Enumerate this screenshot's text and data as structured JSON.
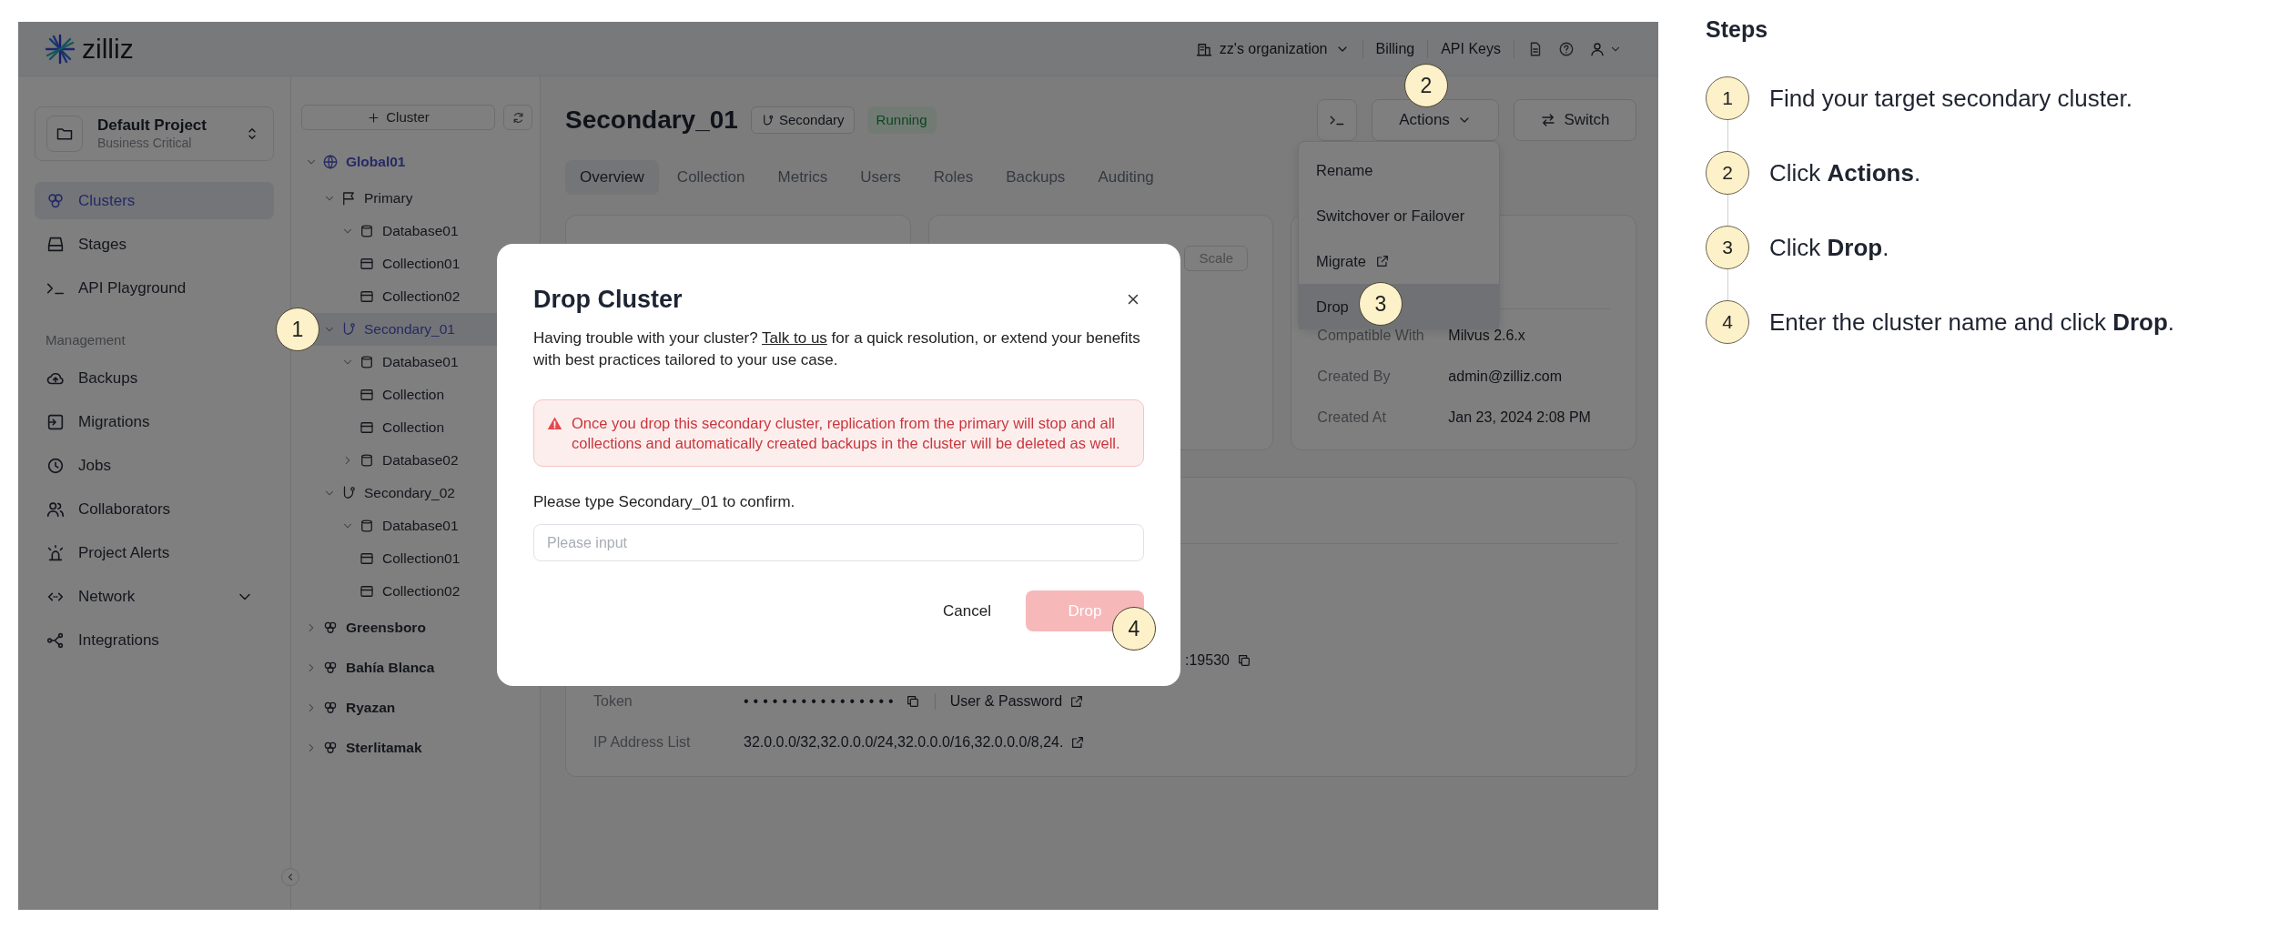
{
  "topbar": {
    "logo": "zilliz",
    "organization": "zz's organization",
    "links": [
      "Billing",
      "API Keys"
    ]
  },
  "sidebar": {
    "project": {
      "name": "Default Project",
      "plan": "Business Critical"
    },
    "items": [
      {
        "label": "Clusters",
        "kind": "clusters",
        "selected": true
      },
      {
        "label": "Stages",
        "kind": "stages",
        "selected": false
      },
      {
        "label": "API Playground",
        "kind": "playground",
        "selected": false
      }
    ],
    "section_title": "Management",
    "section_items": [
      {
        "label": "Backups",
        "kind": "backups",
        "selected": false
      },
      {
        "label": "Migrations",
        "kind": "migrations",
        "selected": false
      },
      {
        "label": "Jobs",
        "kind": "jobs",
        "selected": false
      },
      {
        "label": "Collaborators",
        "kind": "collaborators",
        "selected": false
      },
      {
        "label": "Project Alerts",
        "kind": "alerts",
        "selected": false
      },
      {
        "label": "Network",
        "kind": "network",
        "selected": false,
        "expanded": false
      },
      {
        "label": "Integrations",
        "kind": "integrations",
        "selected": false
      }
    ]
  },
  "tree": {
    "add_button": "Cluster",
    "nodes": [
      {
        "label": "Global01",
        "kind": "global",
        "expanded": true,
        "selected": false,
        "children": [
          {
            "label": "Primary",
            "kind": "primary",
            "expanded": true,
            "selected": false,
            "children": [
              {
                "label": "Database01",
                "kind": "database",
                "expanded": true,
                "selected": false,
                "children": [
                  {
                    "label": "Collection01",
                    "kind": "collection",
                    "selected": false
                  },
                  {
                    "label": "Collection02",
                    "kind": "collection",
                    "selected": false
                  }
                ]
              }
            ]
          },
          {
            "label": "Secondary_01",
            "kind": "secondary",
            "expanded": true,
            "selected": true,
            "children": [
              {
                "label": "Database01",
                "kind": "database",
                "expanded": true,
                "selected": false,
                "children": [
                  {
                    "label": "Collection",
                    "kind": "collection",
                    "selected": false
                  },
                  {
                    "label": "Collection",
                    "kind": "collection",
                    "selected": false
                  }
                ]
              },
              {
                "label": "Database02",
                "kind": "database",
                "expanded": false,
                "selected": false
              }
            ]
          },
          {
            "label": "Secondary_02",
            "kind": "secondary",
            "expanded": true,
            "selected": false,
            "children": [
              {
                "label": "Database01",
                "kind": "database",
                "expanded": true,
                "selected": false,
                "children": [
                  {
                    "label": "Collection01",
                    "kind": "collection",
                    "selected": false
                  },
                  {
                    "label": "Collection02",
                    "kind": "collection",
                    "selected": false
                  }
                ]
              }
            ]
          }
        ]
      },
      {
        "label": "Greensboro",
        "kind": "cluster",
        "expanded": false,
        "selected": false
      },
      {
        "label": "Bahía Blanca",
        "kind": "cluster",
        "expanded": false,
        "selected": false
      },
      {
        "label": "Ryazan",
        "kind": "cluster",
        "expanded": false,
        "selected": false
      },
      {
        "label": "Sterlitamak",
        "kind": "cluster",
        "expanded": false,
        "selected": false
      }
    ]
  },
  "header": {
    "title": "Secondary_01",
    "role": "Secondary",
    "status": "Running",
    "actions_button": "Actions",
    "switch_button": "Switch"
  },
  "tabs": [
    {
      "label": "Overview",
      "selected": true
    },
    {
      "label": "Collection",
      "selected": false
    },
    {
      "label": "Metrics",
      "selected": false
    },
    {
      "label": "Users",
      "selected": false
    },
    {
      "label": "Roles",
      "selected": false
    },
    {
      "label": "Backups",
      "selected": false
    },
    {
      "label": "Auditing",
      "selected": false
    }
  ],
  "actions_menu": [
    {
      "label": "Rename",
      "external": false,
      "highlighted": false
    },
    {
      "label": "Switchover or Failover",
      "external": false,
      "highlighted": false
    },
    {
      "label": "Migrate",
      "external": true,
      "highlighted": false
    },
    {
      "label": "Drop",
      "external": false,
      "highlighted": true
    }
  ],
  "scale_button": "Scale",
  "details": [
    {
      "label": "Compatible With",
      "value": "Milvus 2.6.x"
    },
    {
      "label": "Created By",
      "value": "admin@zilliz.com"
    },
    {
      "label": "Created At",
      "value": "Jan 23, 2024 2:08 PM"
    }
  ],
  "connection": {
    "endpoint": ":19530",
    "token_label": "Token",
    "token_value": "••••••••••••••••",
    "auth": "User & Password",
    "ip_label": "IP Address List",
    "ip_value": "32.0.0.0/32,32.0.0.0/24,32.0.0.0/16,32.0.0.0/8,24."
  },
  "modal": {
    "title": "Drop Cluster",
    "intro_before": "Having trouble with your cluster? ",
    "intro_link": "Talk to us",
    "intro_after": " for a quick resolution, or extend your benefits with best practices tailored to your use case.",
    "warning": "Once you drop this secondary cluster, replication from the primary will stop and all collections and automatically created backups in the cluster will be deleted as well.",
    "confirm_label": "Please type Secondary_01 to confirm.",
    "placeholder": "Please input",
    "cancel_button": "Cancel",
    "drop_button": "Drop",
    "drop_disabled": true
  },
  "callouts": [
    "1",
    "2",
    "3",
    "4"
  ],
  "steps": {
    "title": "Steps",
    "items": [
      {
        "number": "1",
        "text": "Find your target secondary cluster."
      },
      {
        "number": "2",
        "text": "Click **Actions**."
      },
      {
        "number": "3",
        "text": "Click **Drop**."
      },
      {
        "number": "4",
        "text": "Enter the cluster name and click **Drop**."
      }
    ]
  }
}
